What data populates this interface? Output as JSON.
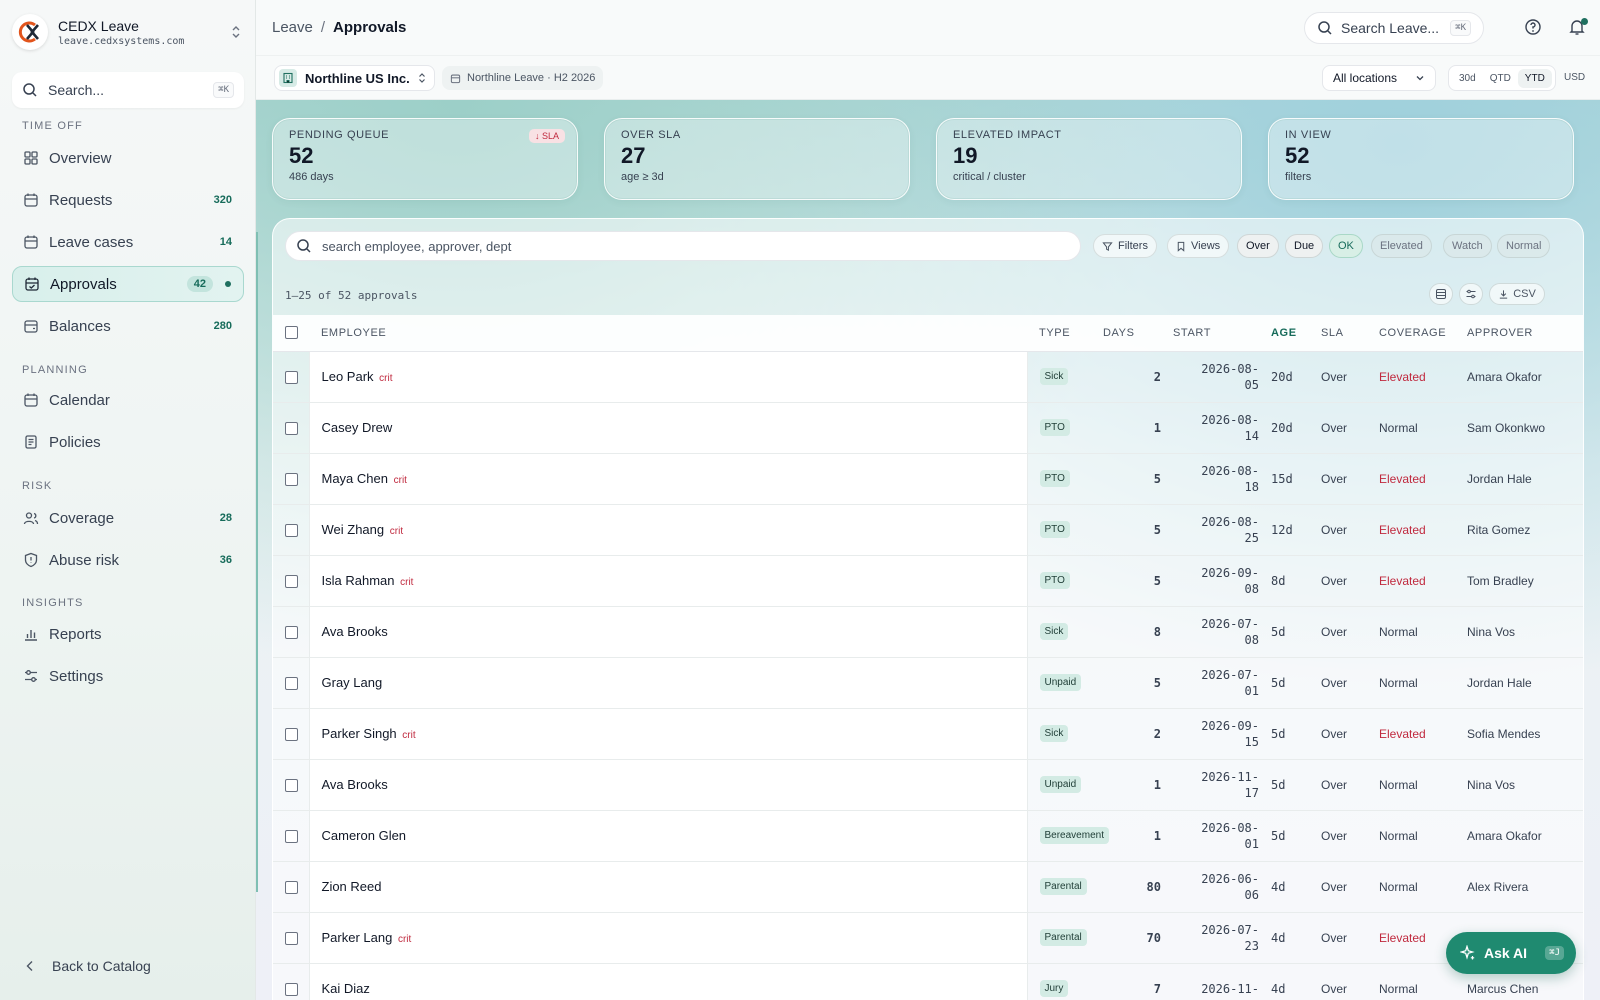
{
  "brand": {
    "name": "CEDX Leave",
    "domain": "leave.cedxsystems.com"
  },
  "sidebar": {
    "search_placeholder": "Search...",
    "search_shortcut": "⌘K",
    "sections": {
      "time_off": "TIME OFF",
      "planning": "PLANNING",
      "risk": "RISK",
      "insights": "INSIGHTS"
    },
    "items": {
      "overview": {
        "label": "Overview",
        "icon": "grid-icon"
      },
      "requests": {
        "label": "Requests",
        "count": "320",
        "icon": "calendar-icon"
      },
      "leave_cases": {
        "label": "Leave cases",
        "count": "14",
        "icon": "calendar-icon"
      },
      "approvals": {
        "label": "Approvals",
        "count": "42",
        "icon": "calendar-check-icon"
      },
      "balances": {
        "label": "Balances",
        "count": "280",
        "icon": "wallet-icon"
      },
      "calendar": {
        "label": "Calendar",
        "icon": "calendar-icon"
      },
      "policies": {
        "label": "Policies",
        "icon": "document-icon"
      },
      "coverage": {
        "label": "Coverage",
        "count": "28",
        "icon": "users-icon"
      },
      "abuse_risk": {
        "label": "Abuse risk",
        "count": "36",
        "icon": "shield-icon"
      },
      "reports": {
        "label": "Reports",
        "icon": "bar-chart-icon"
      },
      "settings": {
        "label": "Settings",
        "icon": "sliders-icon"
      }
    },
    "back_label": "Back to Catalog"
  },
  "header": {
    "breadcrumb_root": "Leave",
    "breadcrumb_sep": "/",
    "breadcrumb_current": "Approvals",
    "search_placeholder": "Search Leave...",
    "search_shortcut": "⌘K"
  },
  "subbar": {
    "org": "Northline US Inc.",
    "period": "Northline Leave · H2 2026",
    "location": "All locations",
    "ranges": [
      "30d",
      "QTD",
      "YTD"
    ],
    "selected_range": "YTD",
    "currency": "USD"
  },
  "kpis": {
    "pending": {
      "label": "PENDING QUEUE",
      "value": "52",
      "sub": "486 days",
      "badge": "↓ SLA"
    },
    "over_sla": {
      "label": "OVER SLA",
      "value": "27",
      "sub": "age ≥ 3d"
    },
    "elevated": {
      "label": "ELEVATED IMPACT",
      "value": "19",
      "sub": "critical / cluster"
    },
    "in_view": {
      "label": "IN VIEW",
      "value": "52",
      "sub": "filters"
    }
  },
  "panel": {
    "search_placeholder": "search employee, approver, dept",
    "filters_label": "Filters",
    "views_label": "Views",
    "chips": {
      "over": "Over",
      "due": "Due",
      "ok": "OK",
      "elevated": "Elevated",
      "watch": "Watch",
      "normal": "Normal"
    },
    "result_count": "1–25 of 52 approvals",
    "csv_label": "CSV"
  },
  "table": {
    "columns": {
      "employee": "EMPLOYEE",
      "type": "TYPE",
      "days": "DAYS",
      "start": "START",
      "age": "AGE",
      "sla": "SLA",
      "coverage": "COVERAGE",
      "approver": "APPROVER"
    },
    "crit_label": "crit",
    "rows": [
      {
        "employee": "Leo Park",
        "crit": true,
        "type": "Sick",
        "days": "2",
        "start1": "2026-08-",
        "start2": "05",
        "age": "20d",
        "sla": "Over",
        "coverage": "Elevated",
        "approver": "Amara Okafor"
      },
      {
        "employee": "Casey Drew",
        "crit": false,
        "type": "PTO",
        "days": "1",
        "start1": "2026-08-",
        "start2": "14",
        "age": "20d",
        "sla": "Over",
        "coverage": "Normal",
        "approver": "Sam Okonkwo"
      },
      {
        "employee": "Maya Chen",
        "crit": true,
        "type": "PTO",
        "days": "5",
        "start1": "2026-08-",
        "start2": "18",
        "age": "15d",
        "sla": "Over",
        "coverage": "Elevated",
        "approver": "Jordan Hale"
      },
      {
        "employee": "Wei Zhang",
        "crit": true,
        "type": "PTO",
        "days": "5",
        "start1": "2026-08-",
        "start2": "25",
        "age": "12d",
        "sla": "Over",
        "coverage": "Elevated",
        "approver": "Rita Gomez"
      },
      {
        "employee": "Isla Rahman",
        "crit": true,
        "type": "PTO",
        "days": "5",
        "start1": "2026-09-",
        "start2": "08",
        "age": "8d",
        "sla": "Over",
        "coverage": "Elevated",
        "approver": "Tom Bradley"
      },
      {
        "employee": "Ava Brooks",
        "crit": false,
        "type": "Sick",
        "days": "8",
        "start1": "2026-07-",
        "start2": "08",
        "age": "5d",
        "sla": "Over",
        "coverage": "Normal",
        "approver": "Nina Vos"
      },
      {
        "employee": "Gray Lang",
        "crit": false,
        "type": "Unpaid",
        "days": "5",
        "start1": "2026-07-",
        "start2": "01",
        "age": "5d",
        "sla": "Over",
        "coverage": "Normal",
        "approver": "Jordan Hale"
      },
      {
        "employee": "Parker Singh",
        "crit": true,
        "type": "Sick",
        "days": "2",
        "start1": "2026-09-",
        "start2": "15",
        "age": "5d",
        "sla": "Over",
        "coverage": "Elevated",
        "approver": "Sofia Mendes"
      },
      {
        "employee": "Ava Brooks",
        "crit": false,
        "type": "Unpaid",
        "days": "1",
        "start1": "2026-11-",
        "start2": "17",
        "age": "5d",
        "sla": "Over",
        "coverage": "Normal",
        "approver": "Nina Vos"
      },
      {
        "employee": "Cameron Glen",
        "crit": false,
        "type": "Bereavement",
        "days": "1",
        "start1": "2026-08-",
        "start2": "01",
        "age": "5d",
        "sla": "Over",
        "coverage": "Normal",
        "approver": "Amara Okafor"
      },
      {
        "employee": "Zion Reed",
        "crit": false,
        "type": "Parental",
        "days": "80",
        "start1": "2026-06-",
        "start2": "06",
        "age": "4d",
        "sla": "Over",
        "coverage": "Normal",
        "approver": "Alex Rivera"
      },
      {
        "employee": "Parker Lang",
        "crit": true,
        "type": "Parental",
        "days": "70",
        "start1": "2026-07-",
        "start2": "23",
        "age": "4d",
        "sla": "Over",
        "coverage": "Elevated",
        "approver": ""
      },
      {
        "employee": "Kai Diaz",
        "crit": false,
        "type": "Jury",
        "days": "7",
        "start1": "2026-11-",
        "start2": "",
        "age": "4d",
        "sla": "Over",
        "coverage": "Normal",
        "approver": "Marcus Chen"
      }
    ]
  },
  "ask_ai": {
    "label": "Ask AI",
    "shortcut": "⌘J"
  },
  "colors": {
    "accent": "#1f8a70",
    "danger": "#c0293e",
    "count": "#166b5a"
  }
}
